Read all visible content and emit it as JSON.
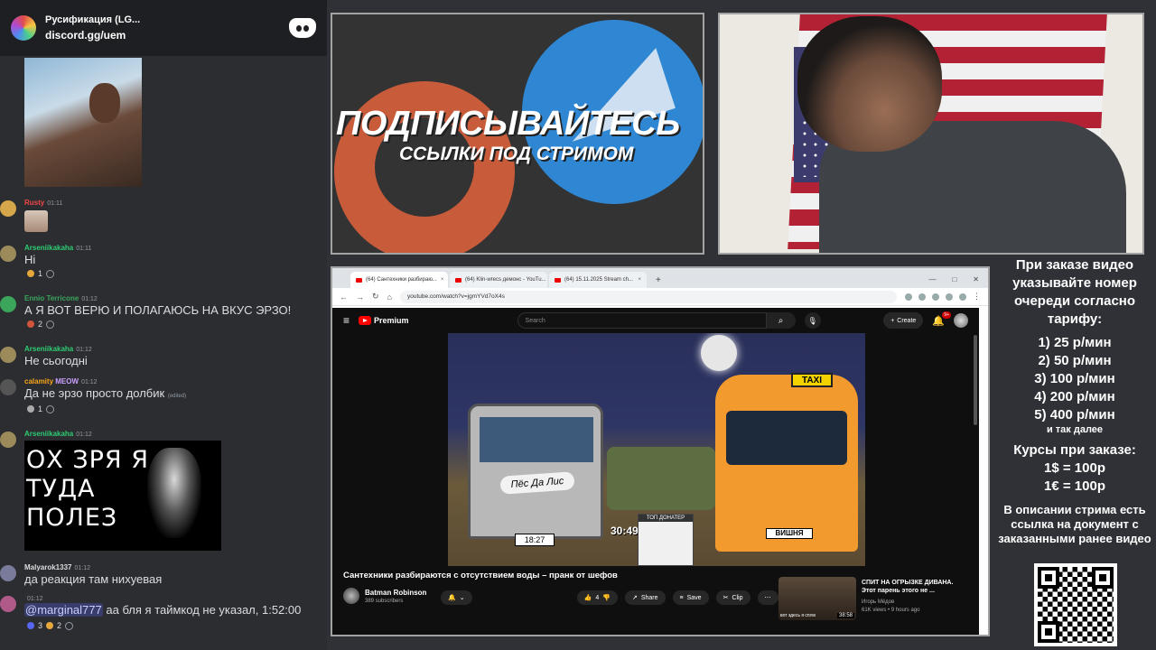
{
  "chat": {
    "server_name": "Русификация (LG...",
    "invite": "discord.gg/uem",
    "messages": [
      {
        "author": "Rusty",
        "time": "01:11",
        "color": "#f04747",
        "text": ""
      },
      {
        "author": "Arseniikakaha",
        "time": "01:11",
        "color": "#2ecc71",
        "text": "Hi",
        "reaction_count": "1"
      },
      {
        "author": "Ennio Terricone",
        "time": "01:12",
        "color": "#3ba55c",
        "text": "А Я ВОТ ВЕРЮ И ПОЛАГАЮСЬ НА ВКУС ЭРЗО!",
        "reaction_count": "2"
      },
      {
        "author": "Arseniikakaha",
        "time": "01:12",
        "color": "#2ecc71",
        "text": "Не сьогодні"
      },
      {
        "author": "calamity",
        "tag": "MEOW",
        "time": "01:12",
        "color": "#faa61a",
        "text": "Да не эрзо просто долбик",
        "edited": "(edited)",
        "reaction_count": "1"
      },
      {
        "author": "Arseniikakaha",
        "time": "01:12",
        "color": "#2ecc71",
        "image_text": [
          "ОХ ЗРЯ Я",
          "ТУДА",
          "ПОЛЕЗ"
        ]
      },
      {
        "author": "Malyarok1337",
        "time": "01:12",
        "color": "#dcddde",
        "text": "да реакция там нихуевая"
      },
      {
        "author": "",
        "time": "01:12",
        "color": "#dcddde",
        "mention": "@marginal777",
        "text": "аа бля я таймкод не указал, 1:52:00",
        "reaction_count_1": "3",
        "reaction_count_2": "2"
      }
    ]
  },
  "promo": {
    "title": "ПОДПИСЫВАЙТЕСЬ",
    "subtitle": "ССЫЛКИ ПОД СТРИМОМ"
  },
  "browser": {
    "tabs": [
      "(64) Сантехники разбираю...",
      "(64) Klin-wrecs демонс - YouTu...",
      "(64) 15.11.2025 Stream ch..."
    ],
    "url": "youtube.com/watch?v=jgmYVd7oX4s"
  },
  "youtube": {
    "logo": "Premium",
    "search_placeholder": "Search",
    "create": "Create",
    "notif_badge": "9+",
    "video_title": "Сантехники разбираются с отсутствием воды – пранк от шефов",
    "channel": "Batman Robinson",
    "subscribers": "389 subscribers",
    "likes": "4",
    "share": "Share",
    "save": "Save",
    "clip": "Clip",
    "thumb": {
      "taxi": "TAXI",
      "sign": "Пёс Да Лис",
      "plate_left": "18:27",
      "plate_right": "ВИШНЯ",
      "timer": "30:49",
      "top_donator": "ТОП ДОНАТЕР"
    },
    "recommended": {
      "title": "СПИТ НА ОГРЫЗКЕ ДИВАНА. Этот парень этого не ...",
      "channel": "Игорь Мёдов",
      "meta": "61K views • 9 hours ago",
      "duration": "38:58",
      "caption": "вот здесь я сплю"
    }
  },
  "info": {
    "intro": "При заказе видео указывайте номер очереди согласно тарифу:",
    "tariffs": [
      "1) 25 р/мин",
      "2) 50 р/мин",
      "3) 100 р/мин",
      "4) 200 р/мин",
      "5) 400 р/мин"
    ],
    "etc": "и так далее",
    "rates_title": "Курсы при заказе:",
    "rate_usd": "1$ = 100р",
    "rate_eur": "1€ = 100р",
    "footer": "В описании стрима есть ссылка на документ с заказанными ранее видео"
  }
}
